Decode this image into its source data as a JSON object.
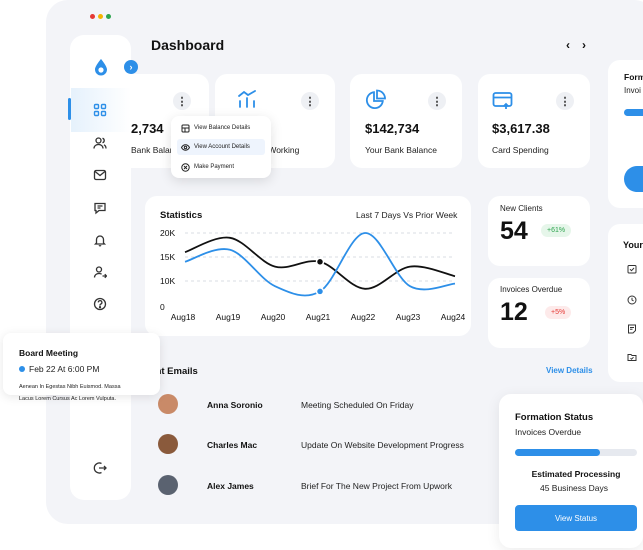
{
  "header": {
    "title": "Dashboard",
    "prev_label": "‹",
    "next_label": "›"
  },
  "window_dots": [
    "#e53935",
    "#f4b400",
    "#2ea44f"
  ],
  "colors": {
    "accent": "#2d8fe8",
    "success": "#2ea44f",
    "danger": "#e53935"
  },
  "sidebar": {
    "items": [
      {
        "icon": "grid-icon",
        "active": true
      },
      {
        "icon": "users-icon",
        "active": false
      },
      {
        "icon": "mail-icon",
        "active": false
      },
      {
        "icon": "chat-icon",
        "active": false
      },
      {
        "icon": "bell-icon",
        "active": false
      },
      {
        "icon": "user-arrow-icon",
        "active": false
      },
      {
        "icon": "help-icon",
        "active": false
      },
      {
        "icon": "logout-icon",
        "active": false
      }
    ]
  },
  "cards": [
    {
      "value": "2,734",
      "label": "Bank Balance",
      "icon": "wallet-icon"
    },
    {
      "value": "",
      "label": "es Working",
      "icon": "chart-bars-icon"
    },
    {
      "value": "$142,734",
      "label": "Your Bank Balance",
      "icon": "pie-icon"
    },
    {
      "value": "$3,617.38",
      "label": "Card Spending",
      "icon": "card-icon"
    }
  ],
  "card_menu": {
    "items": [
      {
        "label": "View Balance Details",
        "icon": "balance-icon"
      },
      {
        "label": "View Account Details",
        "icon": "eye-icon"
      },
      {
        "label": "Make Payment",
        "icon": "payment-icon"
      }
    ]
  },
  "statistics": {
    "title": "Statistics",
    "period": "Last 7 Days Vs Prior Week",
    "y_ticks": [
      "20K",
      "15K",
      "10K",
      "0"
    ],
    "x_ticks": [
      "Aug18",
      "Aug19",
      "Aug20",
      "Aug21",
      "Aug22",
      "Aug23",
      "Aug24"
    ]
  },
  "chart_data": {
    "type": "line",
    "title": "Statistics",
    "x": [
      "Aug18",
      "Aug19",
      "Aug20",
      "Aug21",
      "Aug22",
      "Aug23",
      "Aug24"
    ],
    "ylim": [
      0,
      20000
    ],
    "grid": true,
    "series": [
      {
        "color": "#111111",
        "values": [
          16000,
          19000,
          13000,
          14000,
          7000,
          13000,
          11000
        ]
      },
      {
        "color": "#2d8fe8",
        "values": [
          14000,
          16500,
          8000,
          6000,
          20000,
          8000,
          9000
        ]
      }
    ],
    "highlighted_points": [
      {
        "series": 0,
        "x": "Aug21",
        "y": 14000
      },
      {
        "series": 1,
        "x": "Aug21",
        "y": 6000
      }
    ]
  },
  "new_clients": {
    "label": "New Clients",
    "value": "54",
    "change": "+61%"
  },
  "invoices_overdue": {
    "label": "Invoices Overdue",
    "value": "12",
    "change": "+5%"
  },
  "emails": {
    "title": "cent Emails",
    "view_details": "View Details",
    "rows": [
      {
        "name": "Anna Soronio",
        "subject": "Meeting Scheduled On Friday"
      },
      {
        "name": "Charles Mac",
        "subject": "Update On Website Development Progress"
      },
      {
        "name": "Alex James",
        "subject": "Brief For The New Project From Upwork"
      }
    ]
  },
  "formation": {
    "title": "Formation Status",
    "subtitle": "Invoices Overdue",
    "progress": 0.7,
    "processing_label": "Estimated Processing",
    "processing_value": "45 Business Days",
    "button": "View Status"
  },
  "right_panel": {
    "top_title": "Form",
    "top_sub": "Invoi",
    "bottom_title": "Your",
    "icons": [
      "checklist-icon",
      "clock-icon",
      "note-icon",
      "folder-icon"
    ]
  },
  "meeting": {
    "title": "Board Meeting",
    "time": "Feb 22 At 6:00 PM",
    "desc_line1": "Aenean In Egestas Nibh Euismod. Massa",
    "desc_line2": "Lacus Lorem Cursus Ac Lorem Vulputa."
  }
}
